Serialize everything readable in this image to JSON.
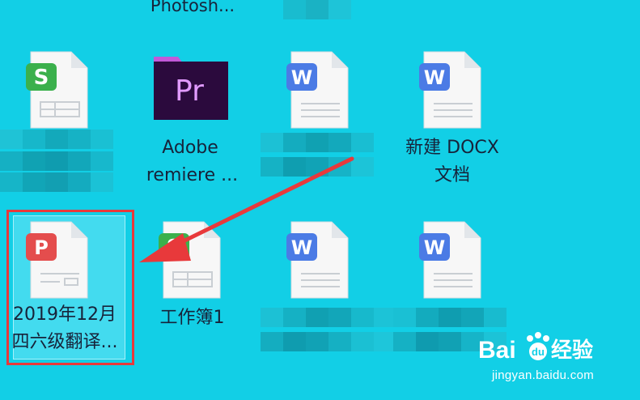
{
  "desktop": {
    "top_partial_label": "Photosh...",
    "icons": [
      {
        "kind": "spreadsheet",
        "label": ""
      },
      {
        "kind": "premiere",
        "glyph": "Pr",
        "label_line1": "Adobe",
        "label_line2": "remiere ..."
      },
      {
        "kind": "word",
        "glyph": "W",
        "label": ""
      },
      {
        "kind": "word",
        "glyph": "W",
        "label_line1": "新建 DOCX",
        "label_line2": "文档"
      },
      {
        "kind": "pdf",
        "glyph": "P",
        "label_line1": "2019年12月",
        "label_line2": "四六级翻译..."
      },
      {
        "kind": "spreadsheet",
        "glyph": "S",
        "label": "工作簿1"
      },
      {
        "kind": "word",
        "glyph": "W",
        "label": ""
      },
      {
        "kind": "word",
        "glyph": "W",
        "label": ""
      }
    ]
  },
  "watermark": {
    "brand": "Bai du 经验",
    "url": "jingyan.baidu.com"
  },
  "colors": {
    "desktop_bg": "#12cfe6",
    "selection_border": "#e8393b",
    "arrow": "#e8393b",
    "word_blue": "#4b7be5",
    "sheet_green": "#3bb04c",
    "pdf_red": "#e44d4d",
    "pr_purple": "#2b0a3d"
  }
}
